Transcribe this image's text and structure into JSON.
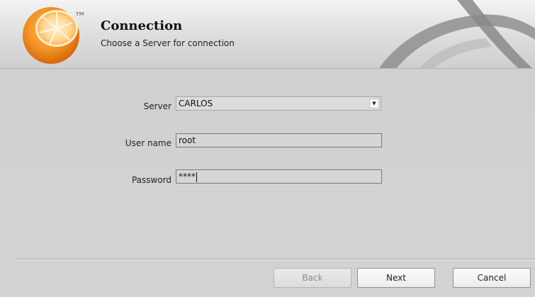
{
  "header": {
    "title": "Connection",
    "subtitle": "Choose a Server for connection",
    "logo_icon": "orange-slice-logo",
    "trademark": "TM"
  },
  "form": {
    "server": {
      "label": "Server",
      "value": "CARLOS"
    },
    "username": {
      "label": "User name",
      "value": "root"
    },
    "password": {
      "label": "Password",
      "value": "****"
    }
  },
  "buttons": {
    "back": "Back",
    "next": "Next",
    "cancel": "Cancel"
  },
  "colors": {
    "orange": "#f28a1c",
    "panel": "#d3d3d3",
    "header_gradient_top": "#f4f4f4"
  }
}
